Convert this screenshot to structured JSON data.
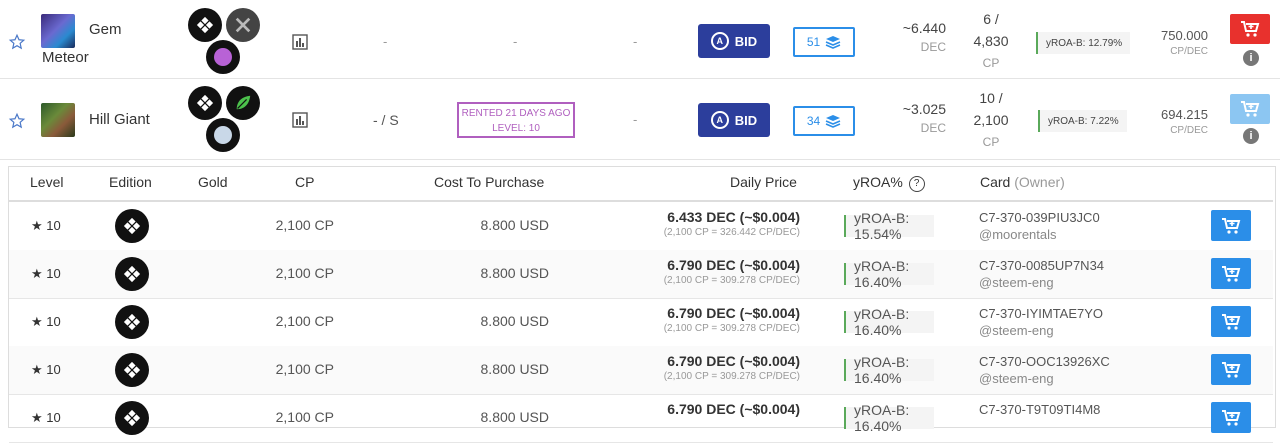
{
  "cards": [
    {
      "name_line1": "Gem",
      "name_line2": "Meteor",
      "rented": "",
      "rented2": "",
      "rental_type": "-",
      "dash_a": "-",
      "dash_b": "-",
      "bid_label": "BID",
      "stack_count": "51",
      "dec_price": "~6.440",
      "dec_unit": "DEC",
      "cp_line1": "6 /",
      "cp_line2": "4,830",
      "cp_line3": "CP",
      "yroa": "yROA-B: 12.79%",
      "cp_per_dec": "750.000",
      "cp_per_dec_unit": "CP/DEC",
      "cart_color": "#e8312d"
    },
    {
      "name_line1": "Hill Giant",
      "rental_type": "- / S",
      "rented": "RENTED 21 DAYS AGO",
      "rented2": "LEVEL: 10",
      "dash_b": "-",
      "bid_label": "BID",
      "stack_count": "34",
      "dec_price": "~3.025",
      "dec_unit": "DEC",
      "cp_line1": "10 /",
      "cp_line2": "2,100",
      "cp_line3": "CP",
      "yroa": "yROA-B: 7.22%",
      "cp_per_dec": "694.215",
      "cp_per_dec_unit": "CP/DEC",
      "cart_color": "#8cc6f2"
    }
  ],
  "table": {
    "headers": {
      "level": "Level",
      "edition": "Edition",
      "gold": "Gold",
      "cp": "CP",
      "cost": "Cost To Purchase",
      "daily": "Daily Price",
      "yroa": "yROA%",
      "card": "Card",
      "owner": "(Owner)"
    },
    "rows": [
      {
        "level": "10",
        "cp": "2,100 CP",
        "usd": "8.800 USD",
        "daily": "6.433 DEC (~$0.004)",
        "daily_sub": "(2,100 CP = 326.442 CP/DEC)",
        "yroa": "yROA-B: 15.54%",
        "card_id": "C7-370-039PIU3JC0",
        "owner": "@moorentals"
      },
      {
        "level": "10",
        "cp": "2,100 CP",
        "usd": "8.800 USD",
        "daily": "6.790 DEC (~$0.004)",
        "daily_sub": "(2,100 CP = 309.278 CP/DEC)",
        "yroa": "yROA-B: 16.40%",
        "card_id": "C7-370-0085UP7N34",
        "owner": "@steem-eng"
      },
      {
        "level": "10",
        "cp": "2,100 CP",
        "usd": "8.800 USD",
        "daily": "6.790 DEC (~$0.004)",
        "daily_sub": "(2,100 CP = 309.278 CP/DEC)",
        "yroa": "yROA-B: 16.40%",
        "card_id": "C7-370-IYIMTAE7YO",
        "owner": "@steem-eng"
      },
      {
        "level": "10",
        "cp": "2,100 CP",
        "usd": "8.800 USD",
        "daily": "6.790 DEC (~$0.004)",
        "daily_sub": "(2,100 CP = 309.278 CP/DEC)",
        "yroa": "yROA-B: 16.40%",
        "card_id": "C7-370-OOC13926XC",
        "owner": "@steem-eng"
      },
      {
        "level": "10",
        "cp": "2,100 CP",
        "usd": "8.800 USD",
        "daily": "6.790 DEC (~$0.004)",
        "daily_sub": "",
        "yroa": "yROA-B: 16.40%",
        "card_id": "C7-370-T9T09TI4M8",
        "owner": ""
      }
    ]
  },
  "colors": {
    "bid_bg": "#2c3e9c",
    "accent_blue": "#2b8ee8",
    "rented_purple": "#b05fbf",
    "yroa_green": "#5aa95a"
  },
  "icons": {
    "favorite": "star-outline-icon",
    "stats": "bar-chart-icon",
    "edition": "untamed-edition-icon",
    "stack": "layers-icon",
    "cart": "cart-plus-icon",
    "info": "info-icon",
    "help": "question-circle-icon"
  }
}
